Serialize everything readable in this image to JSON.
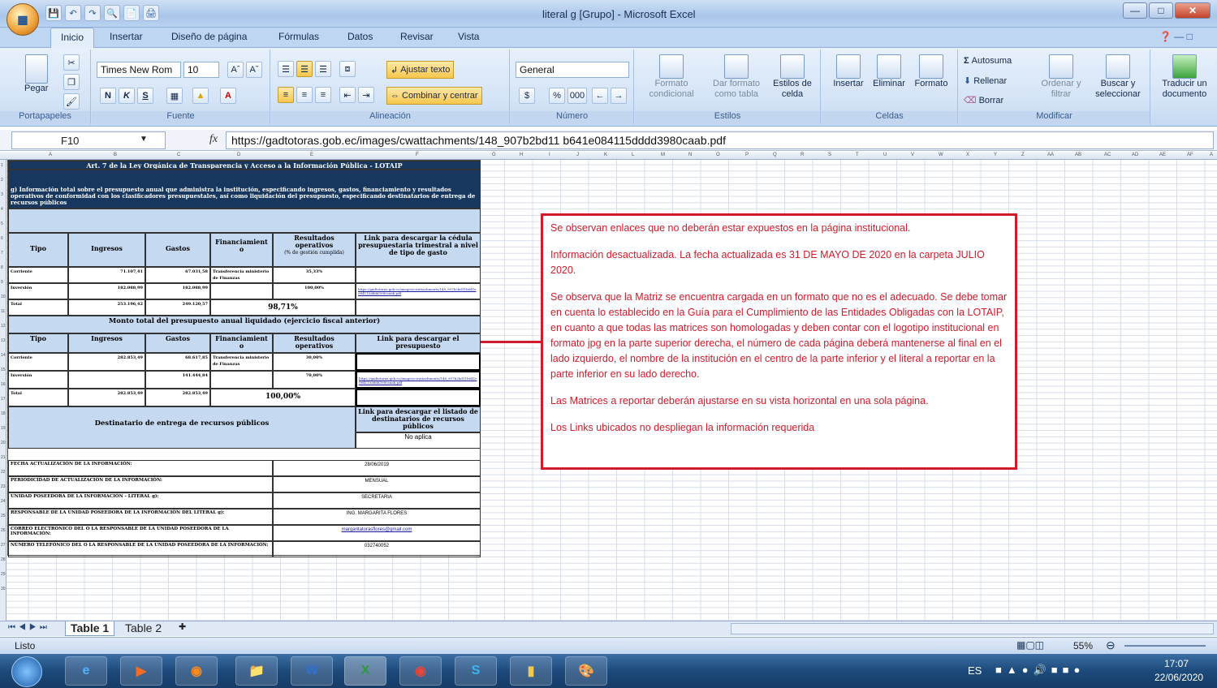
{
  "window": {
    "title": "literal g  [Grupo] - Microsoft Excel"
  },
  "app_button": {
    "label": "Office"
  },
  "ribbon_tabs": [
    "Inicio",
    "Insertar",
    "Diseño de página",
    "Fórmulas",
    "Datos",
    "Revisar",
    "Vista"
  ],
  "ribbon": {
    "clipboard": {
      "paste": "Pegar",
      "group": "Portapapeles"
    },
    "font": {
      "name": "Times New Rom",
      "size": "10",
      "bold": "N",
      "italic": "K",
      "underline": "S",
      "group": "Fuente"
    },
    "alignment": {
      "wrap": "Ajustar texto",
      "merge": "Combinar y centrar",
      "group": "Alineación"
    },
    "number": {
      "format": "General",
      "currency": "$",
      "percent": "%",
      "thousands": "000",
      "group": "Número"
    },
    "styles": {
      "conditional": "Formato condicional",
      "table": "Dar formato como tabla",
      "cell": "Estilos de celda",
      "group": "Estilos"
    },
    "cells": {
      "insert": "Insertar",
      "delete": "Eliminar",
      "format": "Formato",
      "group": "Celdas"
    },
    "editing": {
      "autosum": "Autosuma",
      "fill": "Rellenar",
      "clear": "Borrar",
      "sort": "Ordenar y filtrar",
      "find": "Buscar y seleccionar",
      "group": "Modificar"
    },
    "translate": {
      "label": "Traducir un documento"
    }
  },
  "formula_bar": {
    "cell_ref": "F10",
    "fx": "fx",
    "value": "https://gadtotoras.gob.ec/images/cwattachments/148_907b2bd11 b641e084115dddd3980caab.pdf"
  },
  "columns": [
    "A",
    "B",
    "C",
    "D",
    "E",
    "F",
    "G",
    "H",
    "I",
    "J",
    "K",
    "L",
    "M",
    "N",
    "O",
    "P",
    "Q",
    "R",
    "S",
    "T",
    "U",
    "V",
    "W",
    "X",
    "Y",
    "Z",
    "AA",
    "AB",
    "AC",
    "AD",
    "AE",
    "AF",
    "A"
  ],
  "doc": {
    "title": "Art. 7 de la Ley Orgánica de Transparencia y Acceso a la Información Pública - LOTAIP",
    "description": "g) Información total sobre el presupuesto anual que administra la institución, especificando ingresos, gastos, financiamiento y resultados operativos de conformidad con los clasificadores presupuestales, así como liquidación del presupuesto, especificando destinatarios de entrega de recursos públicos",
    "table1": {
      "headers": [
        "Tipo",
        "Ingresos",
        "Gastos",
        "Financiamient o",
        "Resultados operativos",
        "Link para descargar la cédula presupuestaria trimestral a nivel de tipo de gasto"
      ],
      "subhead": "(% de gestión cumplida)",
      "rows": [
        [
          "Corriente",
          "71.107,41",
          "67.031,58",
          "Transferencia ministerio de Finanzas",
          "35,33%",
          ""
        ],
        [
          "Inversión",
          "182.088,99",
          "182.088,99",
          "",
          "100,00%",
          "https://gadtotoras.gob.ec/images/cwattachments/148_907b2bd11b641e084115dddd3980caab.pdf"
        ],
        [
          "Total",
          "253.196,42",
          "249.120,57",
          "",
          "98,71%",
          ""
        ]
      ]
    },
    "section2": "Monto total del presupuesto anual liquidado (ejercicio fiscal anterior)",
    "table2": {
      "headers": [
        "Tipo",
        "Ingresos",
        "Gastos",
        "Financiamient o",
        "Resultados operativos",
        "Link para descargar el presupuesto"
      ],
      "rows": [
        [
          "Corriente",
          "282.853,49",
          "68.617,85",
          "Transferencia ministerio de Finanzas",
          "30,00%",
          ""
        ],
        [
          "Inversión",
          "",
          "141.444,84",
          "",
          "70,00%",
          "https://gadtotoras.gob.ec/images/cwattachments/148_907b2bd11b641e084115dddd3980caab.pdf"
        ],
        [
          "Total",
          "282.853,49",
          "282.853,49",
          "",
          "100,00%",
          ""
        ]
      ]
    },
    "recipients": {
      "label": "Destinatario de entrega de recursos públicos",
      "link_header": "Link para descargar el listado de destinatarios de recursos públicos",
      "value": "No aplica"
    },
    "info_rows": [
      [
        "FECHA ACTUALIZACIÓN DE LA INFORMACIÓN:",
        "28/06/2019"
      ],
      [
        "PERIODICIDAD DE ACTUALIZACIÓN DE LA INFORMACIÓN:",
        "MENSUAL"
      ],
      [
        "UNIDAD POSEEDORA DE LA INFORMACIÓN - LITERAL g):",
        "SECRETARIA"
      ],
      [
        "RESPONSABLE DE LA UNIDAD POSEEDORA DE LA INFORMACIÓN DEL LITERAL g):",
        "ING. MARGARITA FLORES"
      ],
      [
        "CORREO ELECTRÓNICO DEL O LA RESPONSABLE DE LA UNIDAD POSEEDORA DE LA INFORMACIÓN:",
        "margaritatorasflores@gmail.com"
      ],
      [
        "NÚMERO TELEFÓNICO DEL O LA RESPONSABLE DE LA UNIDAD POSEEDORA DE LA INFORMACIÓN:",
        "032740052"
      ]
    ]
  },
  "comment": {
    "p1": "Se observan enlaces que no deberán estar expuestos en la página institucional.",
    "p2": "Información desactualizada. La fecha actualizada es 31 DE MAYO DE 2020  en la carpeta JULIO 2020.",
    "p3": "Se observa que la Matriz se encuentra cargada en un formato que no es el adecuado. Se debe tomar en cuenta lo establecido en la Guía para el Cumplimiento de las Entidades Obligadas con la LOTAIP, en cuanto a que todas las matrices son homologadas y deben contar con el logotipo institucional en formato jpg en la parte superior derecha, el número de cada página deberá mantenerse al final en el lado izquierdo, el nombre de la institución en el centro de la parte inferior y el literal a reportar en la parte inferior en su lado derecho.",
    "p4": "Las Matrices a reportar deberán ajustarse en su vista horizontal en una sola página.",
    "p5": "Los Links ubicados no despliegan la información requerida"
  },
  "sheet_tabs": [
    "Table 1",
    "Table 2"
  ],
  "status": {
    "ready": "Listo",
    "zoom": "55%"
  },
  "taskbar": {
    "lang": "ES",
    "time": "17:07",
    "date": "22/06/2020"
  },
  "colors": {
    "accent_red": "#d11a2a",
    "header_navy": "#17375e",
    "header_lightblue": "#c5d9f1"
  }
}
